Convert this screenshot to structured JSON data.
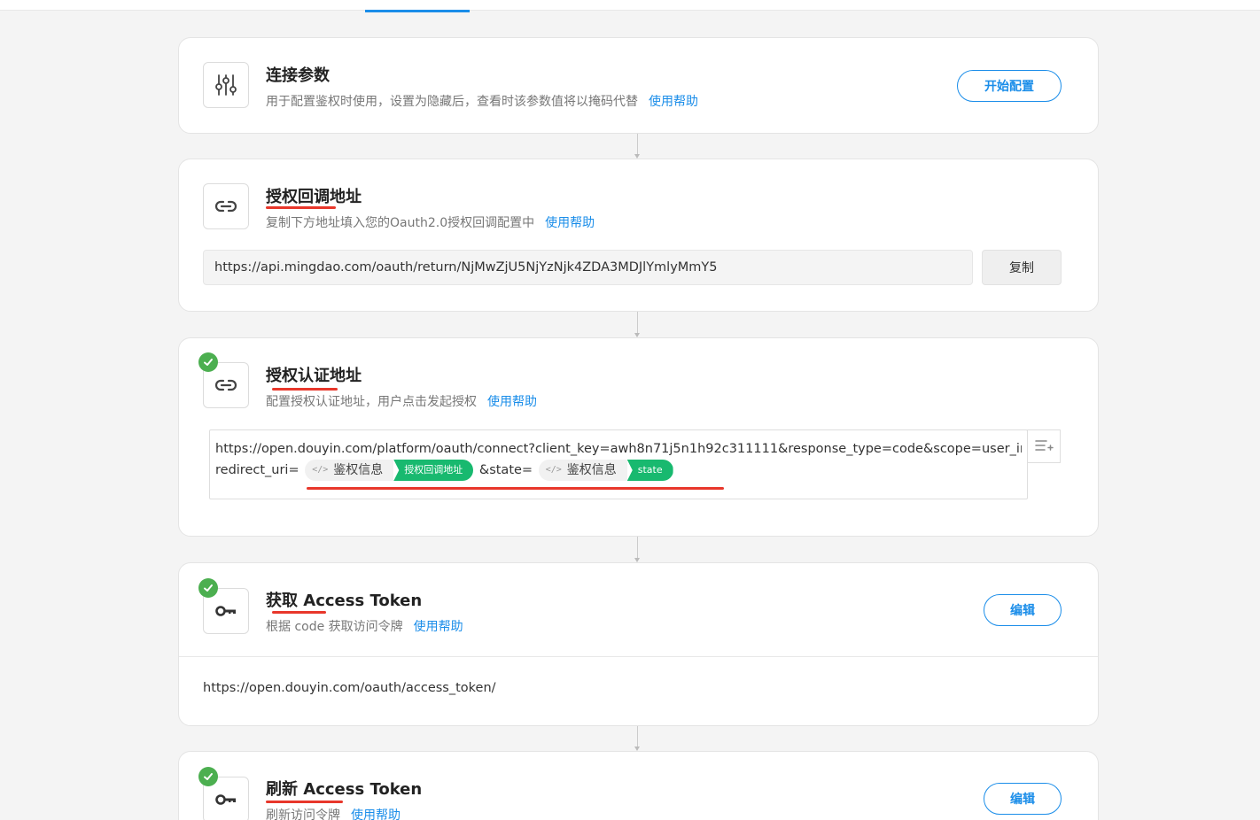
{
  "help_label": "使用帮助",
  "steps": {
    "params": {
      "title": "连接参数",
      "desc": "用于配置鉴权时使用，设置为隐藏后，查看时该参数值将以掩码代替",
      "action": "开始配置"
    },
    "callback": {
      "title": "授权回调地址",
      "desc": "复制下方地址填入您的Oauth2.0授权回调配置中",
      "url": "https://api.mingdao.com/oauth/return/NjMwZjU5NjYzNjk4ZDA3MDJlYmlyMmY5",
      "copy": "复制"
    },
    "auth": {
      "title": "授权认证地址",
      "desc": "配置授权认证地址，用户点击发起授权",
      "url_line1": "https://open.douyin.com/platform/oauth/connect?client_key=awh8n71j5n1h92c311111&response_type=code&scope=user_info&",
      "url_prefix": "redirect_uri=",
      "tag1_source": "鉴权信息",
      "tag1_field": "授权回调地址",
      "url_middle": "&state=",
      "tag2_source": "鉴权信息",
      "tag2_field": "state"
    },
    "access_token": {
      "title": "获取 Access Token",
      "desc": "根据 code 获取访问令牌",
      "action": "编辑",
      "endpoint": "https://open.douyin.com/oauth/access_token/"
    },
    "refresh_token": {
      "title": "刷新 Access Token",
      "desc": "刷新访问令牌",
      "action": "编辑"
    }
  },
  "colors": {
    "accent": "#1a8de9",
    "success": "#4caf50",
    "tag_green": "#18b96f",
    "annotation_red": "#e8372b"
  },
  "icons": [
    "sliders-icon",
    "link-icon",
    "key-icon",
    "check-icon",
    "code-icon",
    "insert-field-icon"
  ]
}
